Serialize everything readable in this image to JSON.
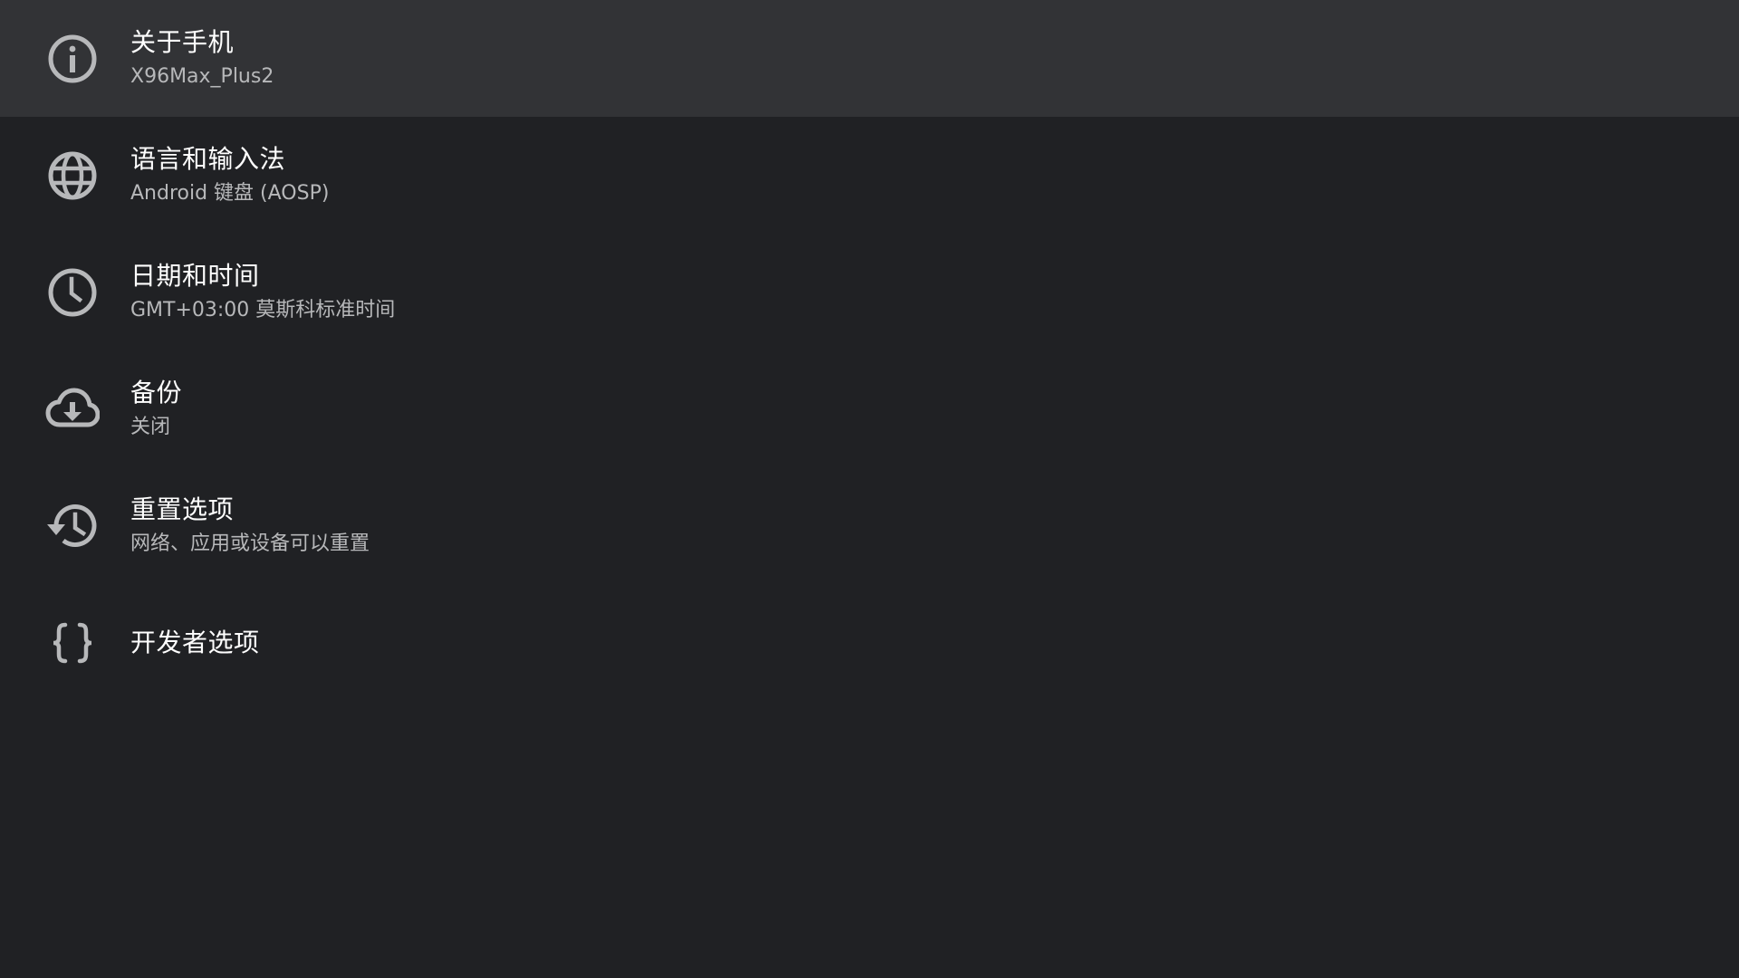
{
  "colors": {
    "background": "#202124",
    "focused_row": "#323336",
    "title_text": "#ffffff",
    "subtitle_text": "#b7b8ba",
    "icon": "#b7b8ba"
  },
  "settings": {
    "items": [
      {
        "icon": "info-icon",
        "title": "关于手机",
        "subtitle": "X96Max_Plus2",
        "focused": true
      },
      {
        "icon": "globe-icon",
        "title": "语言和输入法",
        "subtitle": "Android 键盘 (AOSP)"
      },
      {
        "icon": "clock-icon",
        "title": "日期和时间",
        "subtitle": "GMT+03:00 莫斯科标准时间"
      },
      {
        "icon": "cloud-download-icon",
        "title": "备份",
        "subtitle": "关闭"
      },
      {
        "icon": "history-icon",
        "title": "重置选项",
        "subtitle": "网络、应用或设备可以重置"
      },
      {
        "icon": "braces-icon",
        "title": "开发者选项"
      }
    ]
  }
}
